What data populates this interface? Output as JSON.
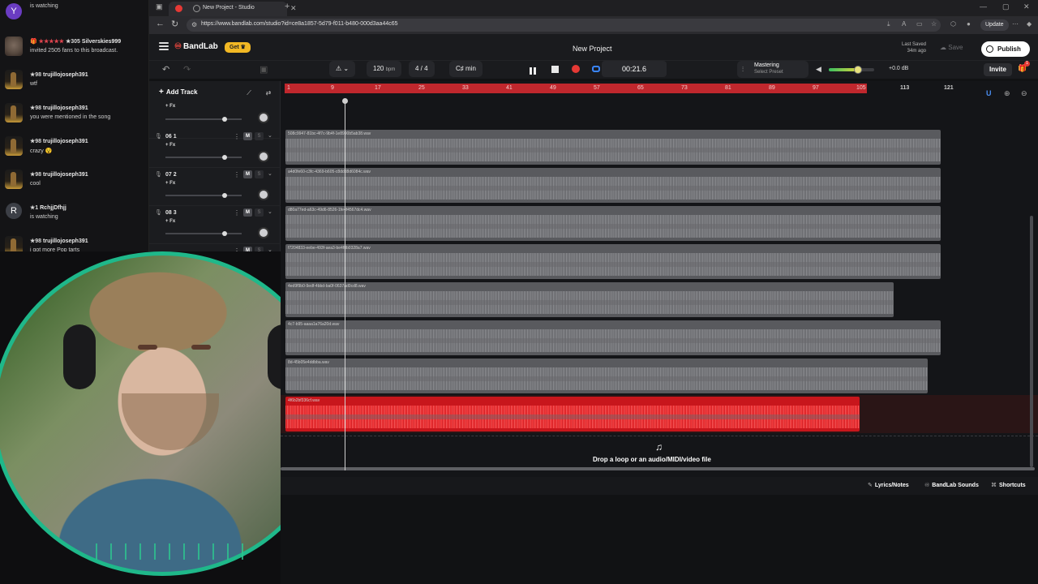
{
  "browser": {
    "tab_title": "New Project - Studio",
    "url": "https://www.bandlab.com/studio?id=ce8a1857-5d79-f011-b480-000d3aa44c65",
    "update_label": "Update"
  },
  "chat": {
    "messages": [
      {
        "avatar": "Y",
        "name": "",
        "badge": "",
        "text": "is watching"
      },
      {
        "avatar": "cat",
        "name": "Silverskies999",
        "badge": "★305",
        "text": "invited 2505 fans to this broadcast."
      },
      {
        "avatar": "figure",
        "name": "trujillojoseph391",
        "badge": "★98",
        "text": "wtf"
      },
      {
        "avatar": "figure",
        "name": "trujillojoseph391",
        "badge": "★98",
        "text": "you were mentioned in the song"
      },
      {
        "avatar": "figure",
        "name": "trujillojoseph391",
        "badge": "★98",
        "text": "crazy 😵"
      },
      {
        "avatar": "figure",
        "name": "trujillojoseph391",
        "badge": "★98",
        "text": "cool"
      },
      {
        "avatar": "R",
        "name": "RchjjDfhjj",
        "badge": "★1",
        "text": "is watching"
      },
      {
        "avatar": "figure",
        "name": "trujillojoseph391",
        "badge": "★98",
        "text": "i got more Pop tarts"
      }
    ]
  },
  "header": {
    "logo": "BandLab",
    "get_label": "Get",
    "project_title": "New Project",
    "last_saved_label": "Last Saved",
    "last_saved_time": "34m ago",
    "save_label": "Save",
    "publish_label": "Publish"
  },
  "transport": {
    "bpm": "120",
    "bpm_unit": "bpm",
    "time_sig": "4 / 4",
    "key": "C♯ min",
    "time": "00:21.6",
    "mastering_title": "Mastering",
    "mastering_sub": "Select Preset",
    "volume_db": "+0.0 dB",
    "volume_level": 0.65,
    "invite_label": "Invite",
    "notification_count": "1"
  },
  "tracklist": {
    "add_track_label": "Add Track",
    "fx_label": "+ Fx",
    "mute_label": "M",
    "solo_label": "S",
    "tracks": [
      {
        "name": ""
      },
      {
        "name": "06  1"
      },
      {
        "name": "07  2"
      },
      {
        "name": "08  3"
      }
    ]
  },
  "ruler": {
    "marks": [
      "1",
      "9",
      "17",
      "25",
      "33",
      "41",
      "49",
      "57",
      "65",
      "73",
      "81",
      "89",
      "97",
      "105",
      "113",
      "121"
    ]
  },
  "clips": [
    {
      "label": "508c9947-81bc-4f7c-9b4f-1e8990b5ab38.wav",
      "color": "#595a5e"
    },
    {
      "label": "a4d0fe60-c3fc-4369-b605-c8ddd8d6084c.wav",
      "color": "#595a5e"
    },
    {
      "label": "d80a77ed-a63c-49d6-8526-1fe4f4567dc4.wav",
      "color": "#595a5e"
    },
    {
      "label": "f7204833-eebe-493f-aea3-be4f8b0328a7.wav",
      "color": "#595a5e"
    },
    {
      "label": "4ed9f9b0-9edf-4bbd-ba0f-0637ad0cd8.wav",
      "color": "#595a5e"
    },
    {
      "label": "4c7-b95-aaaa1a76a20d.wav",
      "color": "#595a5e"
    },
    {
      "label": "8d-45b05e4ddbba.wav",
      "color": "#595a5e"
    },
    {
      "label": "4f6b2bf336cf.wav",
      "color": "#c8161c"
    }
  ],
  "drop_zone": {
    "text": "Drop a loop or an audio/MIDI/video file"
  },
  "bottombar": {
    "lyrics_label": "Lyrics/Notes",
    "sounds_label": "BandLab Sounds",
    "shortcuts_label": "Shortcuts"
  },
  "colors": {
    "accent_red": "#e53935",
    "brand_yellow": "#f2b824",
    "loop_blue": "#3a86ff",
    "webcam_ring": "#1fb88a"
  }
}
